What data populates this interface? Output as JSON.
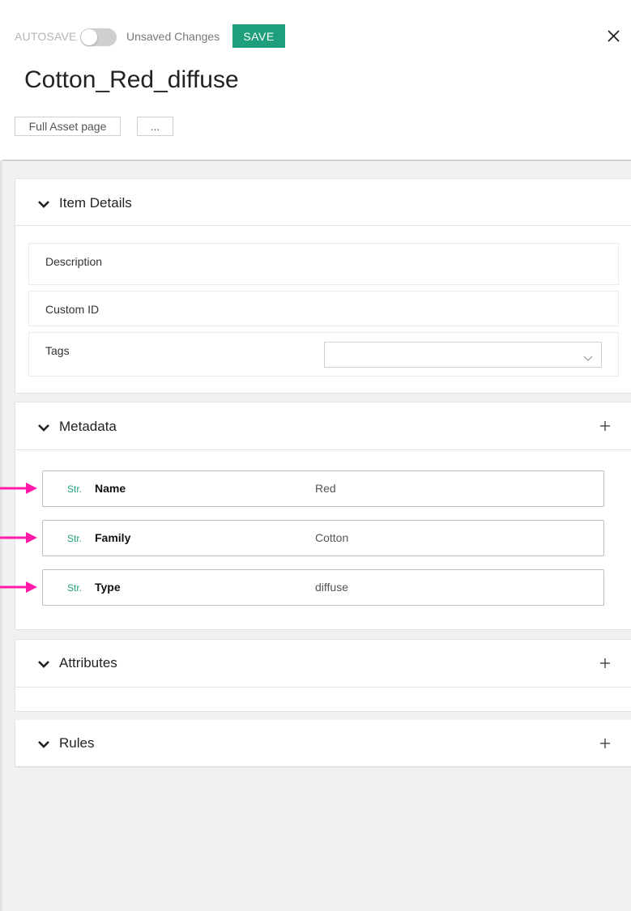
{
  "header": {
    "autosave_label": "AUTOSAVE",
    "autosave_on": false,
    "unsaved_text": "Unsaved Changes",
    "save_label": "SAVE",
    "title": "Cotton_Red_diffuse",
    "full_asset_label": "Full Asset page",
    "more_label": "..."
  },
  "item_details": {
    "title": "Item Details",
    "fields": {
      "description": "Description",
      "custom_id": "Custom ID",
      "tags": "Tags"
    },
    "tags_value": ""
  },
  "metadata": {
    "title": "Metadata",
    "rows": [
      {
        "type": "Str.",
        "key": "Name",
        "value": "Red"
      },
      {
        "type": "Str.",
        "key": "Family",
        "value": "Cotton"
      },
      {
        "type": "Str.",
        "key": "Type",
        "value": "diffuse"
      }
    ]
  },
  "attributes": {
    "title": "Attributes"
  },
  "rules": {
    "title": "Rules"
  },
  "colors": {
    "accent": "#1e9e7a",
    "annotation_arrow": "#ff1aa8"
  },
  "icons": {
    "close": "close-icon",
    "chevron": "chevron-down-icon",
    "plus": "plus-icon",
    "arrow": "arrow-right-icon"
  }
}
